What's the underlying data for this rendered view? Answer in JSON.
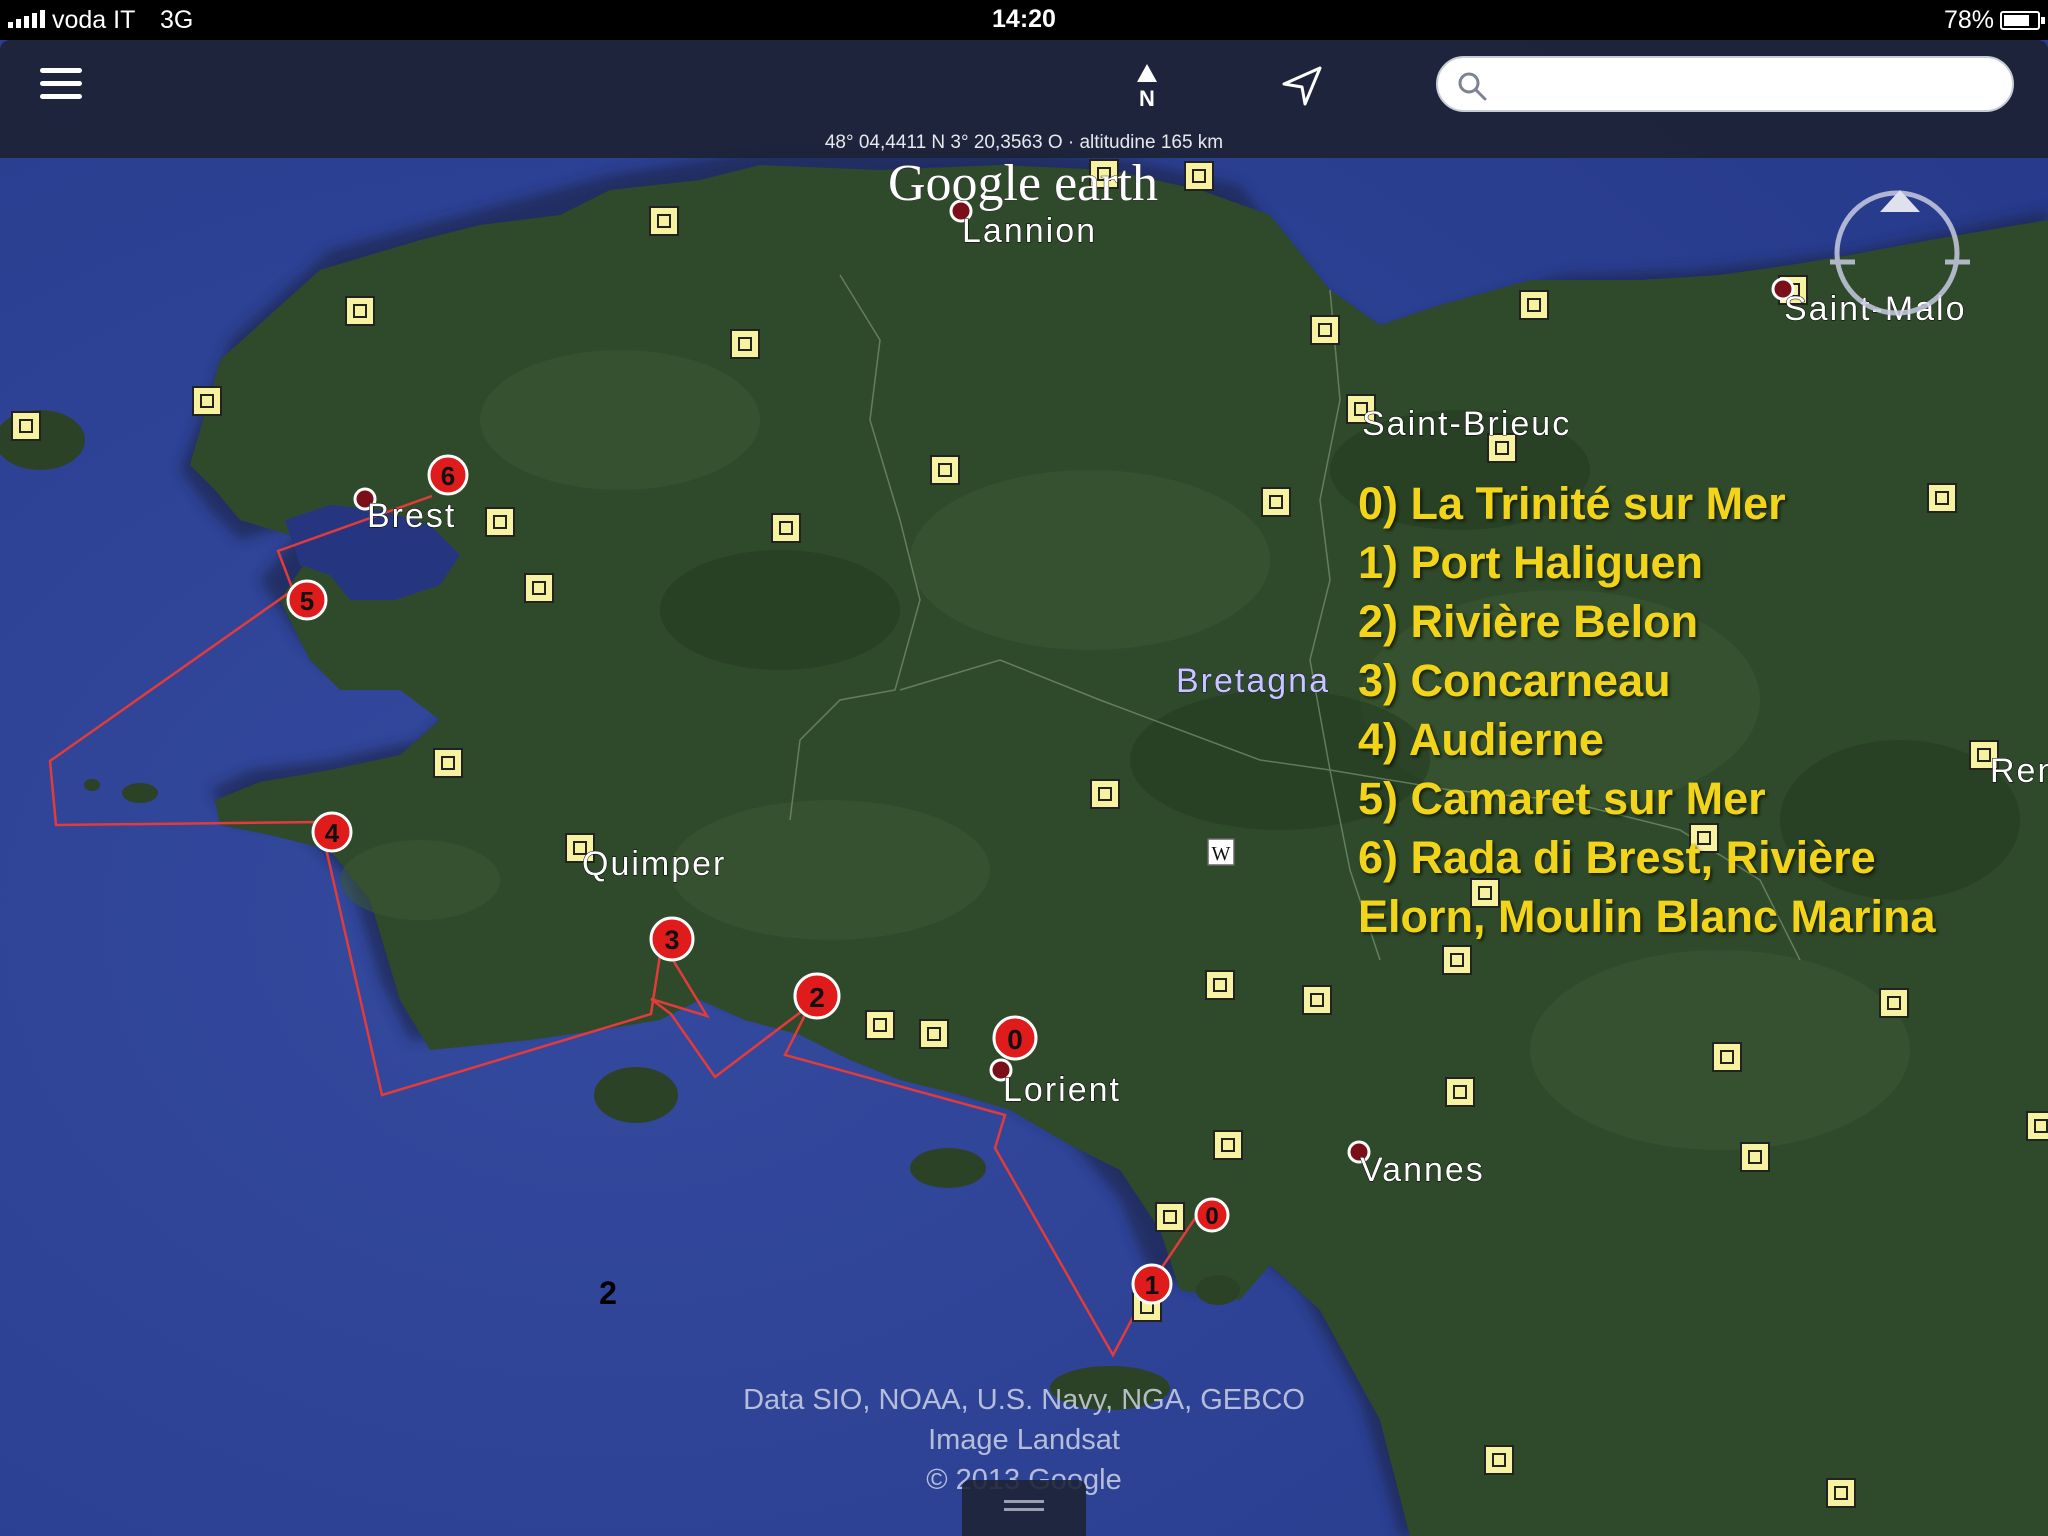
{
  "status_bar": {
    "carrier": "voda IT",
    "network": "3G",
    "time": "14:20",
    "battery": "78%",
    "battery_level": 0.78
  },
  "toolbar": {
    "icons": [
      "menu-icon",
      "north-icon",
      "locate-icon",
      "search-icon"
    ],
    "north_label": "N",
    "search_value": "",
    "search_placeholder": ""
  },
  "coordinates": "48° 04,4411 N  3° 20,3563 O · altitudine 165 km",
  "map": {
    "logo": "Google earth",
    "region_label": "Bretagna",
    "cities": [
      {
        "name": "Lannion"
      },
      {
        "name": "Saint-Malo"
      },
      {
        "name": "Saint-Brieuc"
      },
      {
        "name": "Brest"
      },
      {
        "name": "Quimper"
      },
      {
        "name": "Lorient"
      },
      {
        "name": "Vannes"
      },
      {
        "name": "Ren"
      }
    ],
    "route_markers": [
      "6",
      "5",
      "4",
      "3",
      "2",
      "0",
      "0",
      "1"
    ],
    "stray_label": "2",
    "wiki_badge": "W",
    "colors": {
      "sea": "#2f4599",
      "land": "#2f4a2a",
      "route": "#e23b3b",
      "marker": "#e01b1b",
      "legend": "#f2d51a",
      "placemark": "#f7f2a0"
    }
  },
  "legend": [
    "0) La Trinité sur Mer",
    "1) Port Haliguen",
    "2) Rivière Belon",
    "3) Concarneau",
    "4) Audierne",
    "5) Camaret sur Mer",
    "6) Rada di Brest, Rivière Elorn, Moulin Blanc Marina"
  ],
  "credits": [
    "Data SIO, NOAA, U.S. Navy, NGA, GEBCO",
    "Image Landsat",
    "© 2013 Google"
  ]
}
